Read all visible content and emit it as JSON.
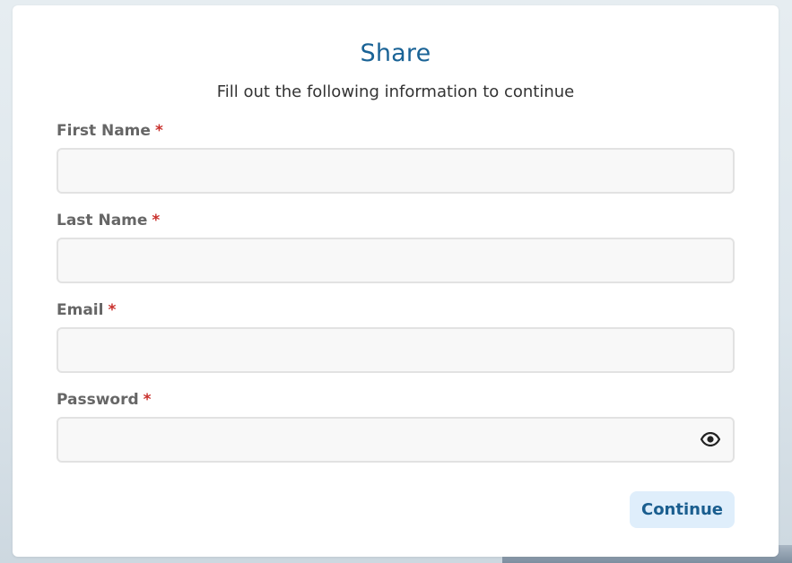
{
  "dialog": {
    "title": "Share",
    "subtitle": "Fill out the following information to continue"
  },
  "fields": [
    {
      "label": "First Name",
      "required_mark": "*",
      "value": "",
      "placeholder": ""
    },
    {
      "label": "Last Name",
      "required_mark": "*",
      "value": "",
      "placeholder": ""
    },
    {
      "label": "Email",
      "required_mark": "*",
      "value": "",
      "placeholder": ""
    },
    {
      "label": "Password",
      "required_mark": "*",
      "value": "",
      "placeholder": "",
      "toggle_icon": "eye-icon"
    }
  ],
  "actions": {
    "continue_label": "Continue"
  },
  "colors": {
    "title": "#1a6396",
    "required": "#c9302c",
    "button_bg": "#dfeefb",
    "button_text": "#1a5e8f"
  }
}
